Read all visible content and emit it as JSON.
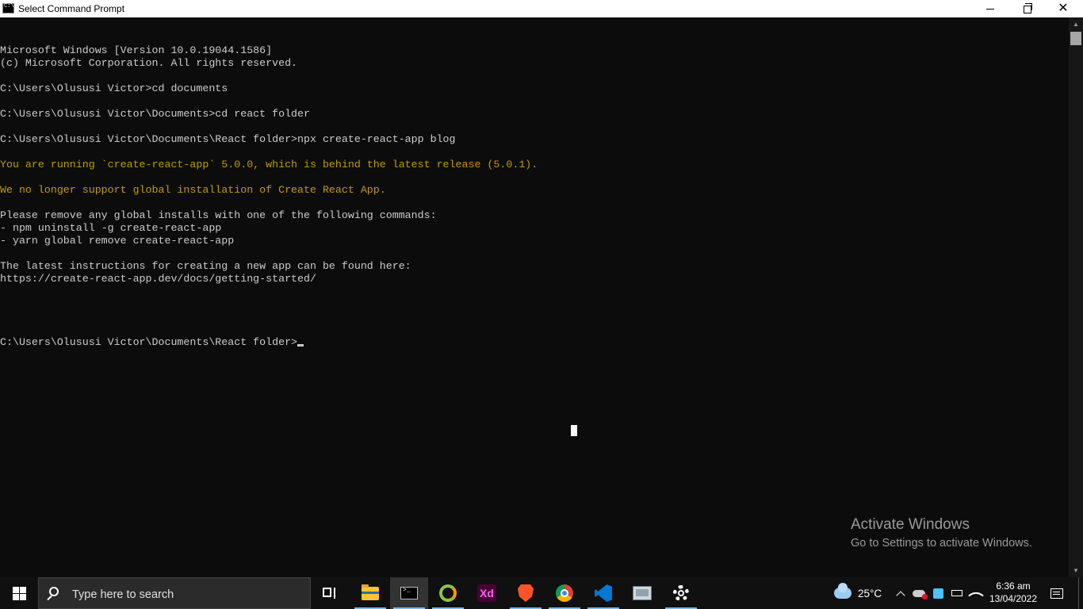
{
  "window": {
    "title": "Select Command Prompt",
    "min_glyph": "",
    "close_glyph": "✕"
  },
  "console": {
    "lines": [
      {
        "text": "Microsoft Windows [Version 10.0.19044.1586]",
        "type": "normal"
      },
      {
        "text": "(c) Microsoft Corporation. All rights reserved.",
        "type": "normal"
      },
      {
        "text": "",
        "type": "normal"
      },
      {
        "text": "C:\\Users\\Olususi Victor>cd documents",
        "type": "normal"
      },
      {
        "text": "",
        "type": "normal"
      },
      {
        "text": "C:\\Users\\Olususi Victor\\Documents>cd react folder",
        "type": "normal"
      },
      {
        "text": "",
        "type": "normal"
      },
      {
        "text": "C:\\Users\\Olususi Victor\\Documents\\React folder>npx create-react-app blog",
        "type": "normal"
      },
      {
        "text": "",
        "type": "normal"
      },
      {
        "text": "You are running `create-react-app` 5.0.0, which is behind the latest release (5.0.1).",
        "type": "warn"
      },
      {
        "text": "",
        "type": "normal"
      },
      {
        "text": "We no longer support global installation of Create React App.",
        "type": "warn"
      },
      {
        "text": "",
        "type": "normal"
      },
      {
        "text": "Please remove any global installs with one of the following commands:",
        "type": "normal"
      },
      {
        "text": "- npm uninstall -g create-react-app",
        "type": "normal"
      },
      {
        "text": "- yarn global remove create-react-app",
        "type": "normal"
      },
      {
        "text": "",
        "type": "normal"
      },
      {
        "text": "The latest instructions for creating a new app can be found here:",
        "type": "normal"
      },
      {
        "text": "https://create-react-app.dev/docs/getting-started/",
        "type": "normal"
      },
      {
        "text": "",
        "type": "normal"
      },
      {
        "text": "",
        "type": "normal"
      }
    ],
    "prompt": "C:\\Users\\Olususi Victor\\Documents\\React folder>",
    "colors": {
      "normal": "#cccccc",
      "warn": "#c19c00",
      "background": "#0c0c0c"
    }
  },
  "watermark": {
    "title": "Activate Windows",
    "subtitle": "Go to Settings to activate Windows."
  },
  "taskbar": {
    "search_placeholder": "Type here to search",
    "apps": [
      {
        "name": "task-view",
        "icon": "task-view-icon"
      },
      {
        "name": "file-explorer",
        "icon": "folder-icon"
      },
      {
        "name": "command-prompt",
        "icon": "cmd-icon"
      },
      {
        "name": "app-chameleon",
        "icon": "chameleon-icon"
      },
      {
        "name": "adobe-xd",
        "icon": "xd-icon",
        "label": "Xd"
      },
      {
        "name": "brave",
        "icon": "brave-icon"
      },
      {
        "name": "chrome",
        "icon": "chrome-icon"
      },
      {
        "name": "vscode",
        "icon": "vscode-icon"
      },
      {
        "name": "remote-desktop",
        "icon": "rdp-icon"
      },
      {
        "name": "settings",
        "icon": "gear-icon"
      }
    ],
    "weather": {
      "temp": "25°C"
    },
    "clock": {
      "time": "6:36 am",
      "date": "13/04/2022"
    }
  }
}
